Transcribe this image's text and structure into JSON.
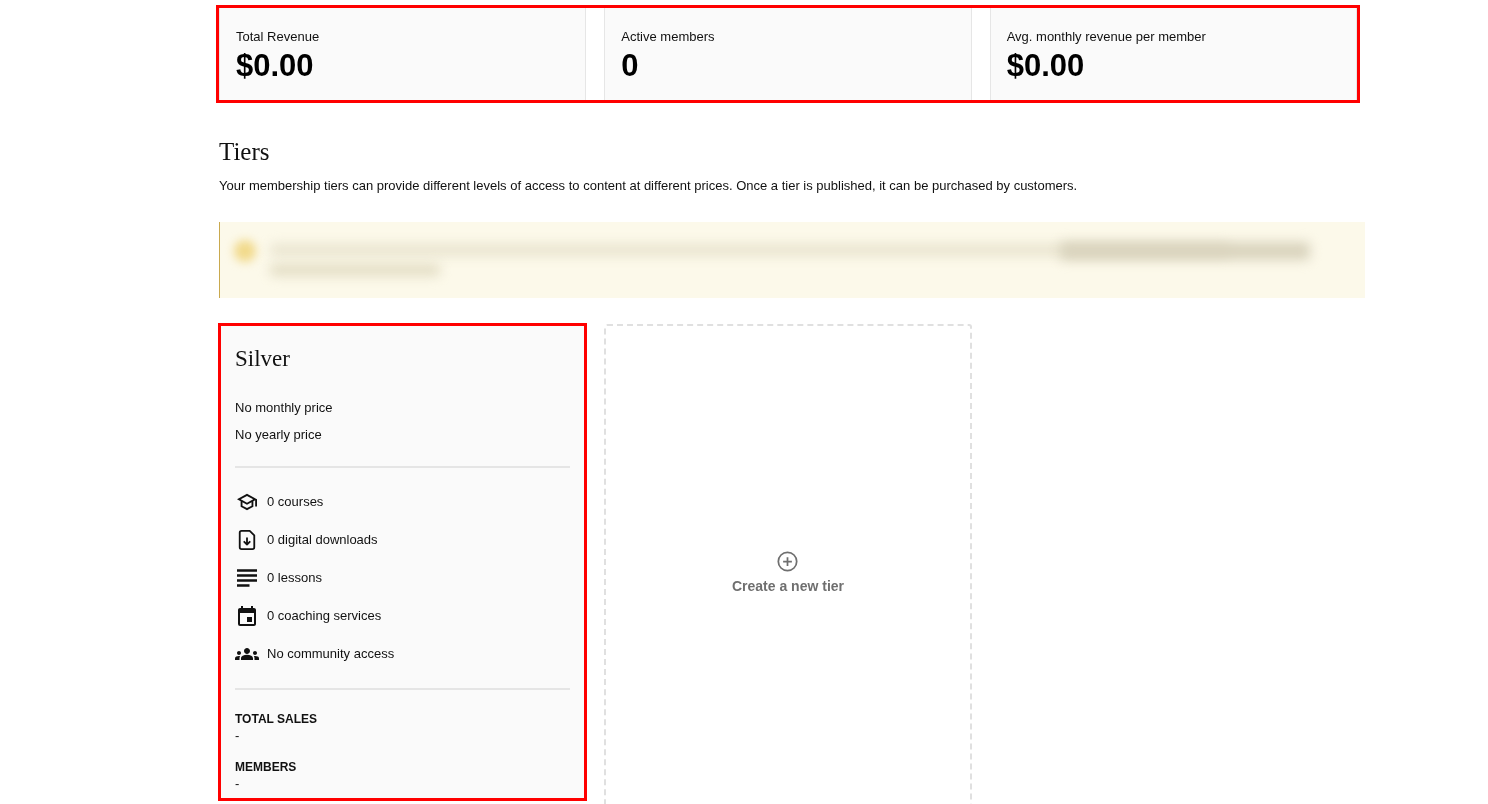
{
  "summary": {
    "highlighted": true,
    "stats": [
      {
        "label": "Total Revenue",
        "value": "$0.00"
      },
      {
        "label": "Active members",
        "value": "0"
      },
      {
        "label": "Avg. monthly revenue per member",
        "value": "$0.00"
      }
    ]
  },
  "tiers_section": {
    "title": "Tiers",
    "description": "Your membership tiers can provide different levels of access to content at different prices. Once a tier is published, it can be purchased by customers.",
    "tiers": [
      {
        "name": "Silver",
        "highlighted": true,
        "prices": [
          "No monthly price",
          "No yearly price"
        ],
        "features": [
          {
            "kind": "course",
            "text": "0 courses"
          },
          {
            "kind": "download",
            "text": "0 digital downloads"
          },
          {
            "kind": "lesson",
            "text": "0 lessons"
          },
          {
            "kind": "coaching",
            "text": "0 coaching services"
          },
          {
            "kind": "community",
            "text": "No community access"
          }
        ],
        "stats": [
          {
            "label": "TOTAL SALES",
            "value": "-"
          },
          {
            "label": "MEMBERS",
            "value": "-"
          }
        ]
      }
    ],
    "create_button": {
      "label": "Create a new tier"
    }
  }
}
